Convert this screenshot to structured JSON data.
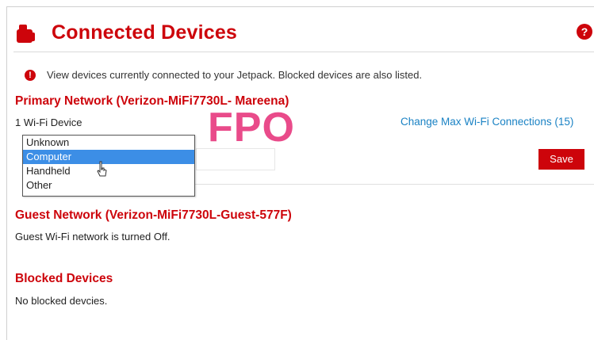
{
  "header": {
    "title": "Connected Devices",
    "help_glyph": "?",
    "icon": "devices-icon"
  },
  "info": {
    "glyph": "!",
    "text": "View devices currently connected to your Jetpack. Blocked devices are also listed."
  },
  "primary_network": {
    "title": "Primary Network (Verizon-MiFi7730L- Mareena)",
    "device_count": "1 Wi-Fi  Device",
    "change_link": "Change Max Wi-Fi Connections (15)",
    "device_type_dropdown": {
      "options": [
        "Unknown",
        "Computer",
        "Handheld",
        "Other"
      ],
      "highlighted": "Computer"
    },
    "save_label": "Save"
  },
  "fpo_label": "FPO",
  "guest_network": {
    "title": "Guest Network (Verizon-MiFi7730L-Guest-577F)",
    "status": "Guest Wi-Fi network is turned Off."
  },
  "blocked_devices": {
    "title": "Blocked Devices",
    "status": "No blocked devcies."
  },
  "colors": {
    "brand_red": "#cd040b",
    "link_blue": "#1a82c4",
    "selection_blue": "#3c8ee6",
    "fpo_pink": "#e94b8a"
  }
}
